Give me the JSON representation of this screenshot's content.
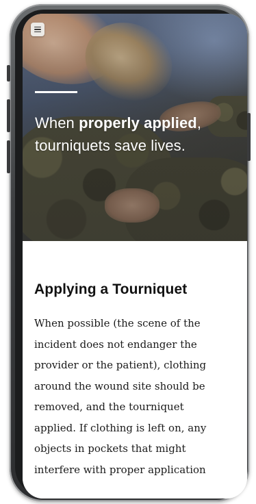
{
  "hero": {
    "menu_icon": "hamburger-menu-icon",
    "headline_prefix": "When ",
    "headline_emphasis": "properly applied",
    "headline_line1_suffix": ",",
    "headline_line2": "tourniquets save lives."
  },
  "article": {
    "title": "Applying a Tourniquet",
    "body_lines": [
      "When possible (the scene of the",
      "incident does not endanger the",
      "provider or the patient), clothing",
      "around the wound site should be",
      "removed, and the tourniquet",
      "applied. If clothing is left on, any",
      "objects in pockets that might",
      "interfere with proper application"
    ]
  }
}
